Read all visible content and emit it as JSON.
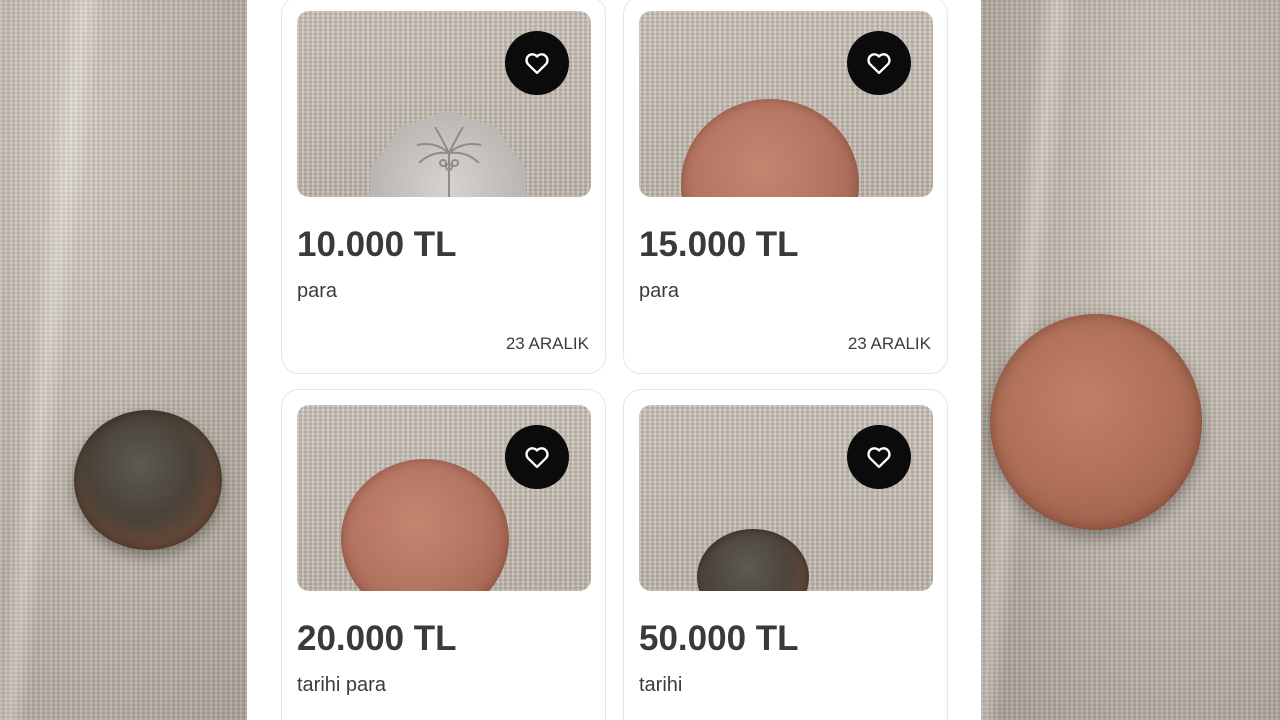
{
  "listings": [
    {
      "price": "10.000 TL",
      "title": "para",
      "date": "23 ARALIK",
      "favorite_icon": "heart-outline-icon"
    },
    {
      "price": "15.000 TL",
      "title": "para",
      "date": "23 ARALIK",
      "favorite_icon": "heart-outline-icon"
    },
    {
      "price": "20.000 TL",
      "title": "tarihi para",
      "favorite_icon": "heart-outline-icon"
    },
    {
      "price": "50.000 TL",
      "title": "tarihi",
      "favorite_icon": "heart-outline-icon"
    }
  ],
  "colors": {
    "panel_bg": "#ffffff",
    "card_border": "#e6e6e6",
    "favorite_button_bg": "#0b0b0b",
    "text": "#3a3a3a"
  }
}
